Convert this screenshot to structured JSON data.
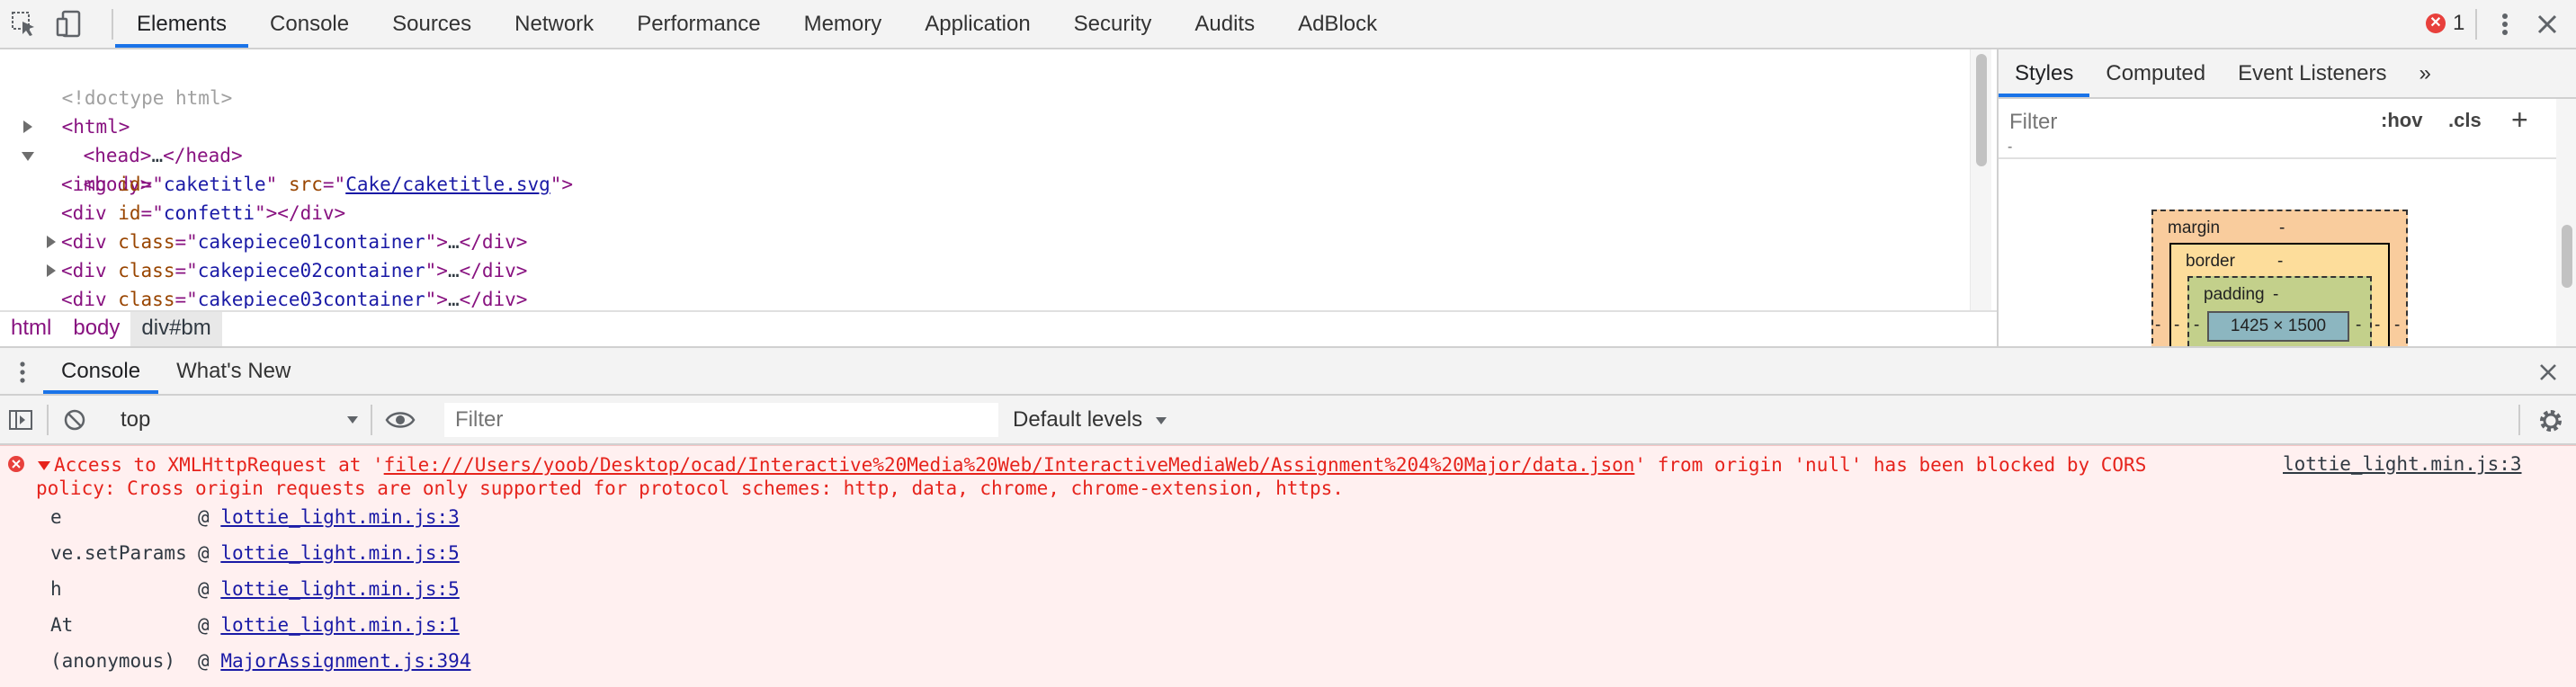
{
  "toolbar": {
    "tabs": [
      "Elements",
      "Console",
      "Sources",
      "Network",
      "Performance",
      "Memory",
      "Application",
      "Security",
      "Audits",
      "AdBlock"
    ],
    "active_tab": "Elements",
    "error_count": "1"
  },
  "elements": {
    "lines": [
      {
        "doctype": "<!doctype html>"
      },
      {
        "open": "<html>"
      },
      {
        "open": "<head>",
        "ellipsis": "…",
        "close": "</head>"
      },
      {
        "open": "<body>"
      },
      {
        "tag": "img",
        "attr1": "id",
        "val1": "caketitle",
        "attr2": "src",
        "val2": "Cake/caketitle.svg"
      },
      {
        "tag": "div",
        "attr1": "id",
        "val1": "confetti",
        "close": "</div>"
      },
      {
        "tag": "div",
        "attr1": "class",
        "val1": "cakepiece01container",
        "ellipsis": "…",
        "close": "</div>"
      },
      {
        "tag": "div",
        "attr1": "class",
        "val1": "cakepiece02container",
        "ellipsis": "…",
        "close": "</div>"
      },
      {
        "tag": "div",
        "attr1": "class",
        "val1": "cakepiece03container",
        "ellipsis": "…",
        "close": "</div>"
      }
    ],
    "breadcrumbs": [
      "html",
      "body",
      "div#bm"
    ]
  },
  "styles_pane": {
    "tabs": [
      "Styles",
      "Computed",
      "Event Listeners"
    ],
    "more": "»",
    "filter_placeholder": "Filter",
    "hov": ":hov",
    "cls": ".cls",
    "plus": "+",
    "dash": "-",
    "box_model": {
      "margin_label": "margin",
      "border_label": "border",
      "padding_label": "padding",
      "margin_val": "-",
      "border_val": "-",
      "padding_val": "-",
      "side_val": "-",
      "content": "1425 × 1500"
    }
  },
  "drawer": {
    "tabs": [
      "Console",
      "What's New"
    ],
    "active_tab": "Console"
  },
  "console_toolbar": {
    "context": "top",
    "filter_placeholder": "Filter",
    "levels": "Default levels"
  },
  "console": {
    "error": {
      "prefix": "Access to XMLHttpRequest at '",
      "url": "file:///Users/yoob/Desktop/ocad/Interactive%20Media%20Web/InteractiveMediaWeb/Assignment%204%20Major/data.json",
      "suffix": "' from origin 'null' has been blocked by CORS",
      "line2": "policy: Cross origin requests are only supported for protocol schemes: http, data, chrome, chrome-extension, https.",
      "source": "lottie_light.min.js:3"
    },
    "stack": [
      {
        "fn": "e",
        "at": "@",
        "src": "lottie_light.min.js:3"
      },
      {
        "fn": "ve.setParams",
        "at": "@",
        "src": "lottie_light.min.js:5"
      },
      {
        "fn": "h",
        "at": "@",
        "src": "lottie_light.min.js:5"
      },
      {
        "fn": "At",
        "at": "@",
        "src": "lottie_light.min.js:1"
      },
      {
        "fn": "(anonymous)",
        "at": "@",
        "src": "MajorAssignment.js:394"
      }
    ]
  },
  "colors": {
    "accent": "#1a73e8",
    "error_red": "#e6231c",
    "error_bg": "#fff0f0",
    "tag": "#881280",
    "attr": "#994500",
    "value": "#1a1aa6"
  }
}
